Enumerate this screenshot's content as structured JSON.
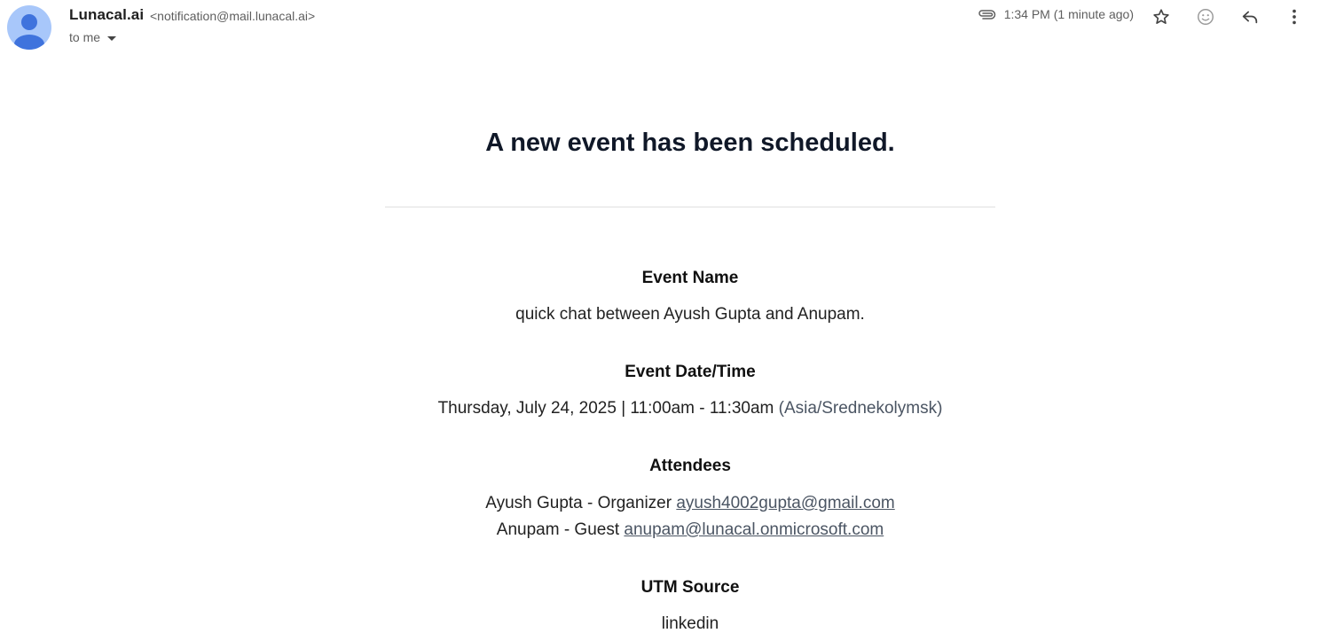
{
  "sender": {
    "name": "Lunacal.ai",
    "email": "<notification@mail.lunacal.ai>",
    "recipient": "to me"
  },
  "meta": {
    "timestamp": "1:34 PM (1 minute ago)"
  },
  "actions": {
    "icons": [
      "star-icon",
      "emoji-icon",
      "reply-icon",
      "more-vert-icon"
    ]
  },
  "email": {
    "headline": "A new event has been scheduled.",
    "event_name": {
      "label": "Event Name",
      "value": "quick chat between Ayush Gupta and Anupam."
    },
    "event_datetime": {
      "label": "Event Date/Time",
      "value": "Thursday, July 24, 2025 | 11:00am - 11:30am",
      "timezone": "(Asia/Srednekolymsk)"
    },
    "attendees": {
      "label": "Attendees",
      "list": [
        {
          "text": "Ayush Gupta - Organizer",
          "email": "ayush4002gupta@gmail.com"
        },
        {
          "text": "Anupam - Guest",
          "email": "anupam@lunacal.onmicrosoft.com"
        }
      ]
    },
    "utm_source": {
      "label": "UTM Source",
      "value": "linkedin"
    }
  },
  "colors": {
    "avatar_bg": "#a8c7fa",
    "avatar_fg": "#4285f4",
    "headline": "#101828",
    "link": "#4b5563"
  }
}
